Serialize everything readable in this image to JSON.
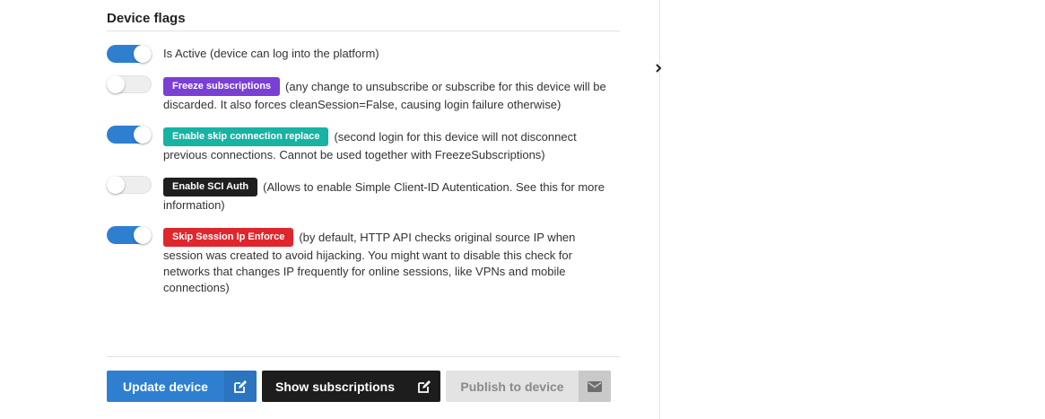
{
  "section": {
    "title": "Device flags"
  },
  "flags": [
    {
      "on": true,
      "badge": "",
      "badge_color": "",
      "text": "Is Active (device can log into the platform)"
    },
    {
      "on": false,
      "badge": "Freeze subscriptions",
      "badge_color": "#7a3fd4",
      "text": "(any change to unsubscribe or subscribe for this device will be discarded. It also forces cleanSession=False, causing login failure otherwise)"
    },
    {
      "on": true,
      "badge": "Enable skip connection replace",
      "badge_color": "#17b3a3",
      "text": "(second login for this device will not disconnect previous connections. Cannot be used together with FreezeSubscriptions)"
    },
    {
      "on": false,
      "badge": "Enable SCI Auth",
      "badge_color": "#1f1f1f",
      "text": "(Allows to enable Simple Client-ID Autentication. See this for more information)"
    },
    {
      "on": true,
      "badge": "Skip Session Ip Enforce",
      "badge_color": "#e0262d",
      "text": "(by default, HTTP API checks original source IP when session was created to avoid hijacking. You might want to disable this check for networks that changes IP frequently for online sessions, like VPNs and mobile connections)"
    }
  ],
  "buttons": {
    "update": {
      "label": "Update device",
      "icon": "edit-icon",
      "color": "#2f7fd1",
      "icon_bg": "#2a74c0"
    },
    "subscriptions": {
      "label": "Show subscriptions",
      "icon": "edit-icon",
      "color": "#1d1d1d"
    },
    "publish": {
      "label": "Publish to device",
      "icon": "envelope-icon",
      "color": "#e3e3e3",
      "icon_bg": "#c9c9c9"
    }
  },
  "side_panel": {
    "toggle_icon": "chevron-right-icon"
  }
}
